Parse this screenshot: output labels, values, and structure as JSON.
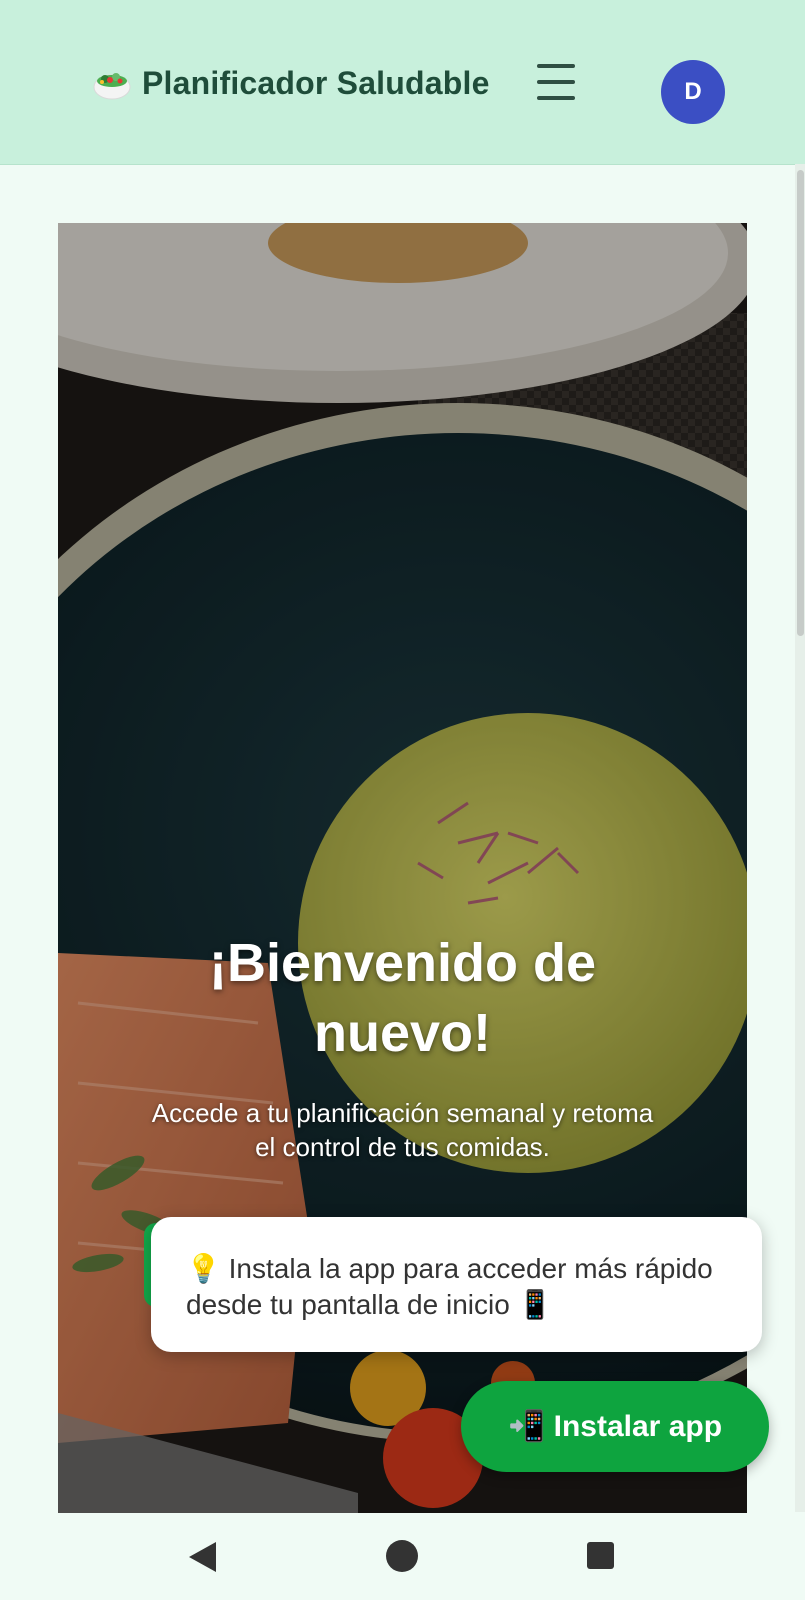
{
  "header": {
    "brand_icon": "salad-bowl-icon",
    "title": "Planificador Saludable",
    "menu_icon": "hamburger-menu-icon",
    "avatar_initial": "D",
    "avatar_color": "#3b4fc4",
    "background_color": "#c8f0dc"
  },
  "hero": {
    "background_image": "food-plate-photo",
    "title": "¡Bienvenido de nuevo!",
    "subtitle": "Accede a tu planificación semanal y retoma el control de tus comidas."
  },
  "install_toast": {
    "text": "💡 Instala la app para acceder más rápido desde tu pantalla de inicio 📱"
  },
  "install_button": {
    "label": "📲 Instalar app",
    "color": "#0ea43f"
  },
  "system_nav": {
    "back_icon": "back-triangle-icon",
    "home_icon": "home-circle-icon",
    "recents_icon": "recents-square-icon"
  }
}
